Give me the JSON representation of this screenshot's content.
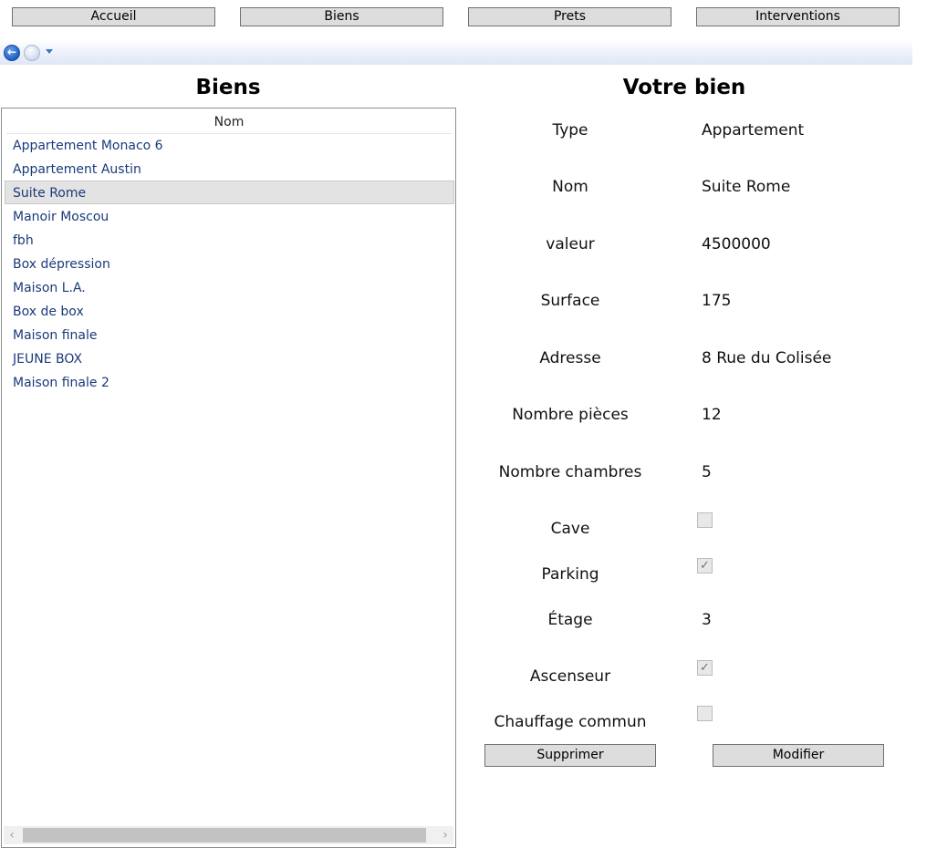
{
  "nav": {
    "accueil": "Accueil",
    "biens": "Biens",
    "prets": "Prets",
    "interventions": "Interventions"
  },
  "history": {
    "back": "←",
    "forward": "→"
  },
  "list": {
    "title": "Biens",
    "column_header": "Nom",
    "items": [
      "Appartement Monaco 6",
      "Appartement Austin",
      "Suite Rome",
      "Manoir Moscou",
      "fbh",
      "Box dépression",
      "Maison L.A.",
      "Box de box",
      "Maison finale",
      "JEUNE BOX",
      "Maison finale 2"
    ],
    "selected_index": 2,
    "scroll_left": "‹",
    "scroll_right": "›"
  },
  "detail": {
    "title": "Votre bien",
    "labels": {
      "type": "Type",
      "nom": "Nom",
      "valeur": "valeur",
      "surface": "Surface",
      "adresse": "Adresse",
      "nb_pieces": "Nombre pièces",
      "nb_chambres": "Nombre chambres",
      "cave": "Cave",
      "parking": "Parking",
      "etage": "Étage",
      "ascenseur": "Ascenseur",
      "chauffage": "Chauffage commun"
    },
    "values": {
      "type": "Appartement",
      "nom": "Suite Rome",
      "valeur": "4500000",
      "surface": "175",
      "adresse": "8 Rue du Colisée",
      "nb_pieces": "12",
      "nb_chambres": "5",
      "etage": "3"
    },
    "checks": {
      "cave": false,
      "parking": true,
      "ascenseur": true,
      "chauffage": false
    },
    "check_mark": "✓"
  },
  "actions": {
    "supprimer": "Supprimer",
    "modifier": "Modifier"
  }
}
